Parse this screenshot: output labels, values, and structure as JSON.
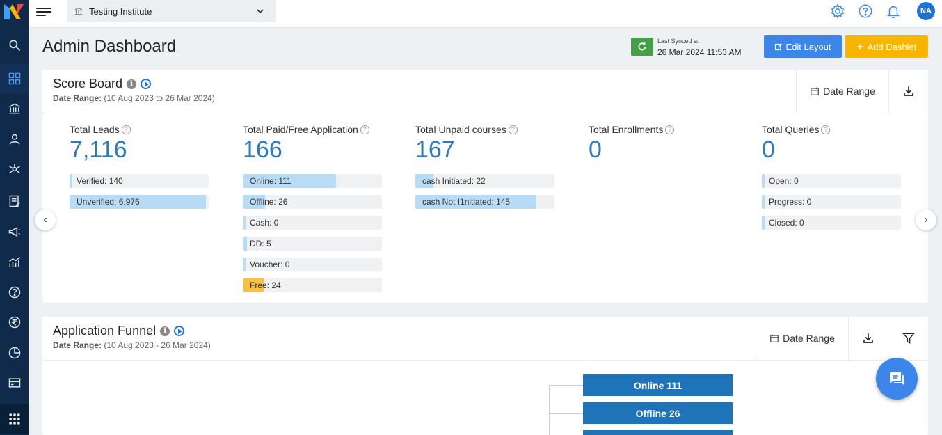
{
  "topbar": {
    "institute": "Testing Institute",
    "avatar_initials": "NA"
  },
  "header": {
    "title": "Admin Dashboard",
    "sync_label": "Last Synced at",
    "sync_time": "26 Mar 2024 11:53 AM",
    "edit_layout": "Edit Layout",
    "add_dashlet": "Add Dashlet"
  },
  "scoreboard": {
    "title": "Score Board",
    "date_range_label": "Date Range:",
    "date_range_value": "(10 Aug 2023 to 26 Mar 2024)",
    "date_range_button": "Date Range",
    "columns": [
      {
        "label": "Total Leads",
        "value": "7,116",
        "bars": [
          {
            "text": "Verified: 140",
            "fraction": 0.02,
            "color": "#b9dcf6"
          },
          {
            "text": "Unverified: 6,976",
            "fraction": 0.98,
            "color": "#b9dcf6"
          }
        ]
      },
      {
        "label": "Total Paid/Free Application",
        "value": "166",
        "bars": [
          {
            "text": "Online: 111",
            "fraction": 0.67,
            "color": "#b9dcf6"
          },
          {
            "text": "Offline: 26",
            "fraction": 0.16,
            "color": "#b9dcf6"
          },
          {
            "text": "Cash: 0",
            "fraction": 0,
            "color": "#b9dcf6"
          },
          {
            "text": "DD: 5",
            "fraction": 0.03,
            "color": "#b9dcf6"
          },
          {
            "text": "Voucher: 0",
            "fraction": 0,
            "color": "#b9dcf6"
          },
          {
            "text": "Free: 24",
            "fraction": 0.15,
            "color": "#f6c244"
          }
        ]
      },
      {
        "label": "Total Unpaid courses",
        "value": "167",
        "bars": [
          {
            "text": "cash Initiated: 22",
            "fraction": 0.13,
            "color": "#b9dcf6"
          },
          {
            "text": "cash Not I1nitiated: 145",
            "fraction": 0.87,
            "color": "#b9dcf6"
          }
        ]
      },
      {
        "label": "Total Enrollments",
        "value": "0",
        "bars": []
      },
      {
        "label": "Total Queries",
        "value": "0",
        "bars": [
          {
            "text": "Open: 0",
            "fraction": 0,
            "color": "#b9dcf6"
          },
          {
            "text": "Progress: 0",
            "fraction": 0,
            "color": "#b9dcf6"
          },
          {
            "text": "Closed: 0",
            "fraction": 0,
            "color": "#b9dcf6"
          }
        ]
      }
    ]
  },
  "funnel": {
    "title": "Application Funnel",
    "date_range_label": "Date Range:",
    "date_range_value": "(10 Aug 2023 - 26 Mar 2024)",
    "date_range_button": "Date Range",
    "stages": [
      "Online 111",
      "Offline 26"
    ]
  },
  "colors": {
    "sidebar": "#0f2a4a",
    "accent_blue": "#3b86e8",
    "accent_yellow": "#f7b500",
    "sync_green": "#43a047",
    "value_blue": "#2b7bbf"
  }
}
